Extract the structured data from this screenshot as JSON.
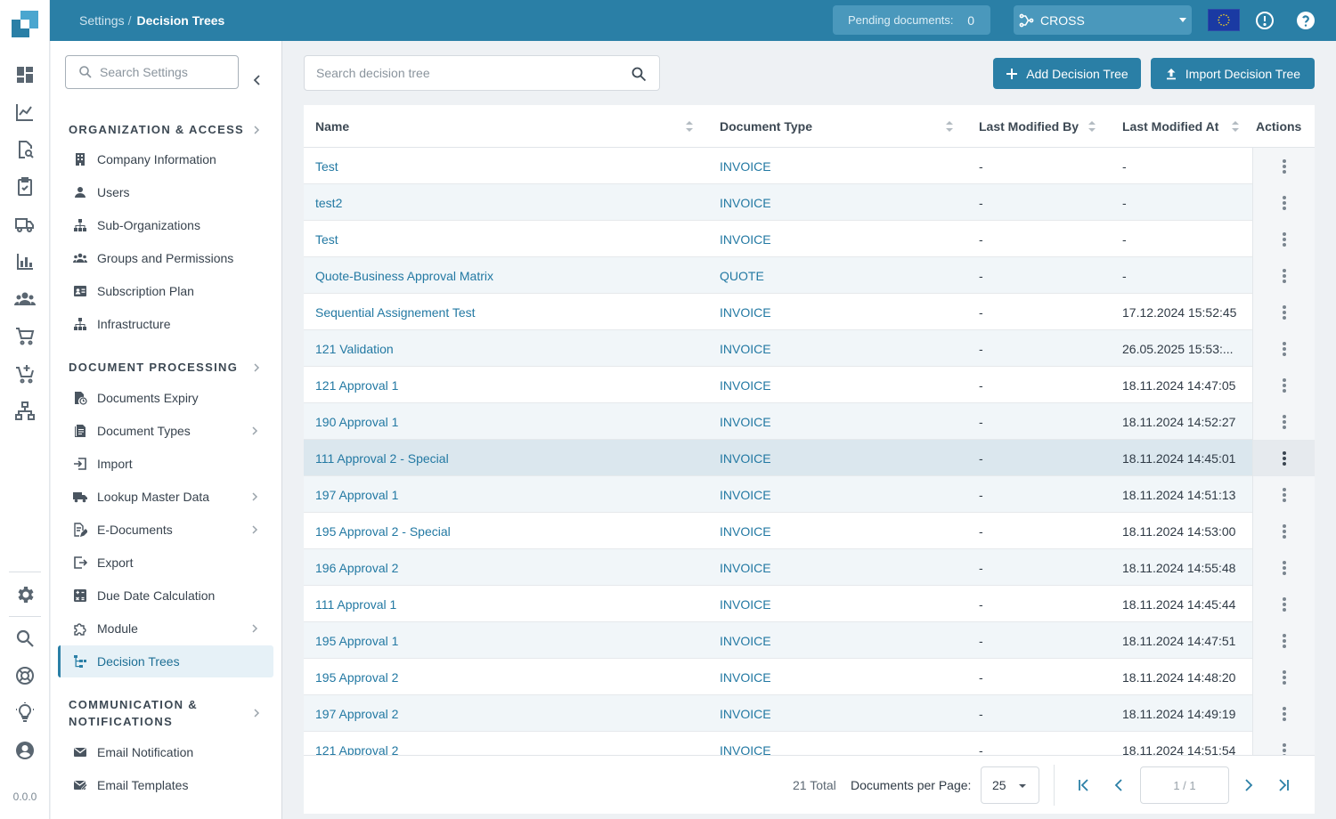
{
  "header": {
    "breadcrumb": [
      "Settings",
      "Decision Trees"
    ],
    "breadcrumb_separator": "/",
    "pending_label": "Pending documents:",
    "pending_count": "0",
    "organization": "CROSS",
    "icons": [
      "eu-flag-icon",
      "alert-circle-icon",
      "help-icon"
    ]
  },
  "rail": {
    "icons": [
      "dashboard-icon",
      "analytics-chart-icon",
      "document-search-icon",
      "task-clipboard-icon",
      "delivery-truck-icon",
      "bar-chart-icon",
      "team-icon",
      "cart-icon",
      "cart-add-icon",
      "network-icon",
      "settings-gear-icon",
      "search-icon",
      "support-lifebuoy-icon",
      "lightbulb-icon",
      "account-icon"
    ],
    "version": "0.0.0"
  },
  "sidebar": {
    "search_placeholder": "Search Settings",
    "sections": [
      {
        "title": "ORGANIZATION & ACCESS",
        "items": [
          {
            "label": "Company Information",
            "icon": "building-icon"
          },
          {
            "label": "Users",
            "icon": "user-icon"
          },
          {
            "label": "Sub-Organizations",
            "icon": "hierarchy-icon"
          },
          {
            "label": "Groups and Permissions",
            "icon": "groups-icon"
          },
          {
            "label": "Subscription Plan",
            "icon": "id-card-icon"
          },
          {
            "label": "Infrastructure",
            "icon": "hierarchy-icon"
          }
        ]
      },
      {
        "title": "DOCUMENT PROCESSING",
        "items": [
          {
            "label": "Documents Expiry",
            "icon": "document-clock-icon"
          },
          {
            "label": "Document Types",
            "icon": "documents-icon",
            "has_submenu": true
          },
          {
            "label": "Import",
            "icon": "import-icon"
          },
          {
            "label": "Lookup Master Data",
            "icon": "truck-icon",
            "has_submenu": true
          },
          {
            "label": "E-Documents",
            "icon": "edit-document-icon",
            "has_submenu": true
          },
          {
            "label": "Export",
            "icon": "export-icon"
          },
          {
            "label": "Due Date Calculation",
            "icon": "calculator-icon"
          },
          {
            "label": "Module",
            "icon": "puzzle-icon",
            "has_submenu": true
          },
          {
            "label": "Decision Trees",
            "icon": "tree-icon",
            "active": true
          }
        ]
      },
      {
        "title_lines": [
          "COMMUNICATION &",
          "NOTIFICATIONS"
        ],
        "items": [
          {
            "label": "Email Notification",
            "icon": "email-icon"
          },
          {
            "label": "Email Templates",
            "icon": "email-template-icon"
          }
        ]
      }
    ]
  },
  "main": {
    "search_placeholder": "Search decision tree",
    "add_button": "Add Decision Tree",
    "import_button": "Import Decision Tree",
    "columns": [
      "Name",
      "Document Type",
      "Last Modified By",
      "Last Modified At",
      "Actions"
    ],
    "rows": [
      {
        "name": "Test",
        "type": "INVOICE",
        "by": "-",
        "at": "-"
      },
      {
        "name": "test2",
        "type": "INVOICE",
        "by": "-",
        "at": "-"
      },
      {
        "name": "Test",
        "type": "INVOICE",
        "by": "-",
        "at": "-"
      },
      {
        "name": "Quote-Business Approval Matrix",
        "type": "QUOTE",
        "by": "-",
        "at": "-"
      },
      {
        "name": "Sequential Assignement Test",
        "type": "INVOICE",
        "by": "-",
        "at": "17.12.2024 15:52:45"
      },
      {
        "name": "121 Validation",
        "type": "INVOICE",
        "by": "-",
        "at": "26.05.2025 15:53:..."
      },
      {
        "name": "121 Approval 1",
        "type": "INVOICE",
        "by": "-",
        "at": "18.11.2024 14:47:05"
      },
      {
        "name": "190 Approval 1",
        "type": "INVOICE",
        "by": "-",
        "at": "18.11.2024 14:52:27"
      },
      {
        "name": "111 Approval 2 - Special",
        "type": "INVOICE",
        "by": "-",
        "at": "18.11.2024 14:45:01",
        "hovered": true
      },
      {
        "name": "197 Approval 1",
        "type": "INVOICE",
        "by": "-",
        "at": "18.11.2024 14:51:13"
      },
      {
        "name": "195 Approval 2 - Special",
        "type": "INVOICE",
        "by": "-",
        "at": "18.11.2024 14:53:00"
      },
      {
        "name": "196 Approval 2",
        "type": "INVOICE",
        "by": "-",
        "at": "18.11.2024 14:55:48"
      },
      {
        "name": "111 Approval 1",
        "type": "INVOICE",
        "by": "-",
        "at": "18.11.2024 14:45:44"
      },
      {
        "name": "195 Approval 1",
        "type": "INVOICE",
        "by": "-",
        "at": "18.11.2024 14:47:51"
      },
      {
        "name": "195 Approval 2",
        "type": "INVOICE",
        "by": "-",
        "at": "18.11.2024 14:48:20"
      },
      {
        "name": "197 Approval 2",
        "type": "INVOICE",
        "by": "-",
        "at": "18.11.2024 14:49:19"
      },
      {
        "name": "121 Approval 2",
        "type": "INVOICE",
        "by": "-",
        "at": "18.11.2024 14:51:54"
      }
    ],
    "footer": {
      "total": "21 Total",
      "per_page_label": "Documents per Page:",
      "per_page_value": "25",
      "page": "1 / 1"
    }
  },
  "colors": {
    "primary": "#2a7fa6",
    "link": "#2379a3",
    "hover_row": "#dbe7ee",
    "alt_row": "#f1f6f9"
  }
}
